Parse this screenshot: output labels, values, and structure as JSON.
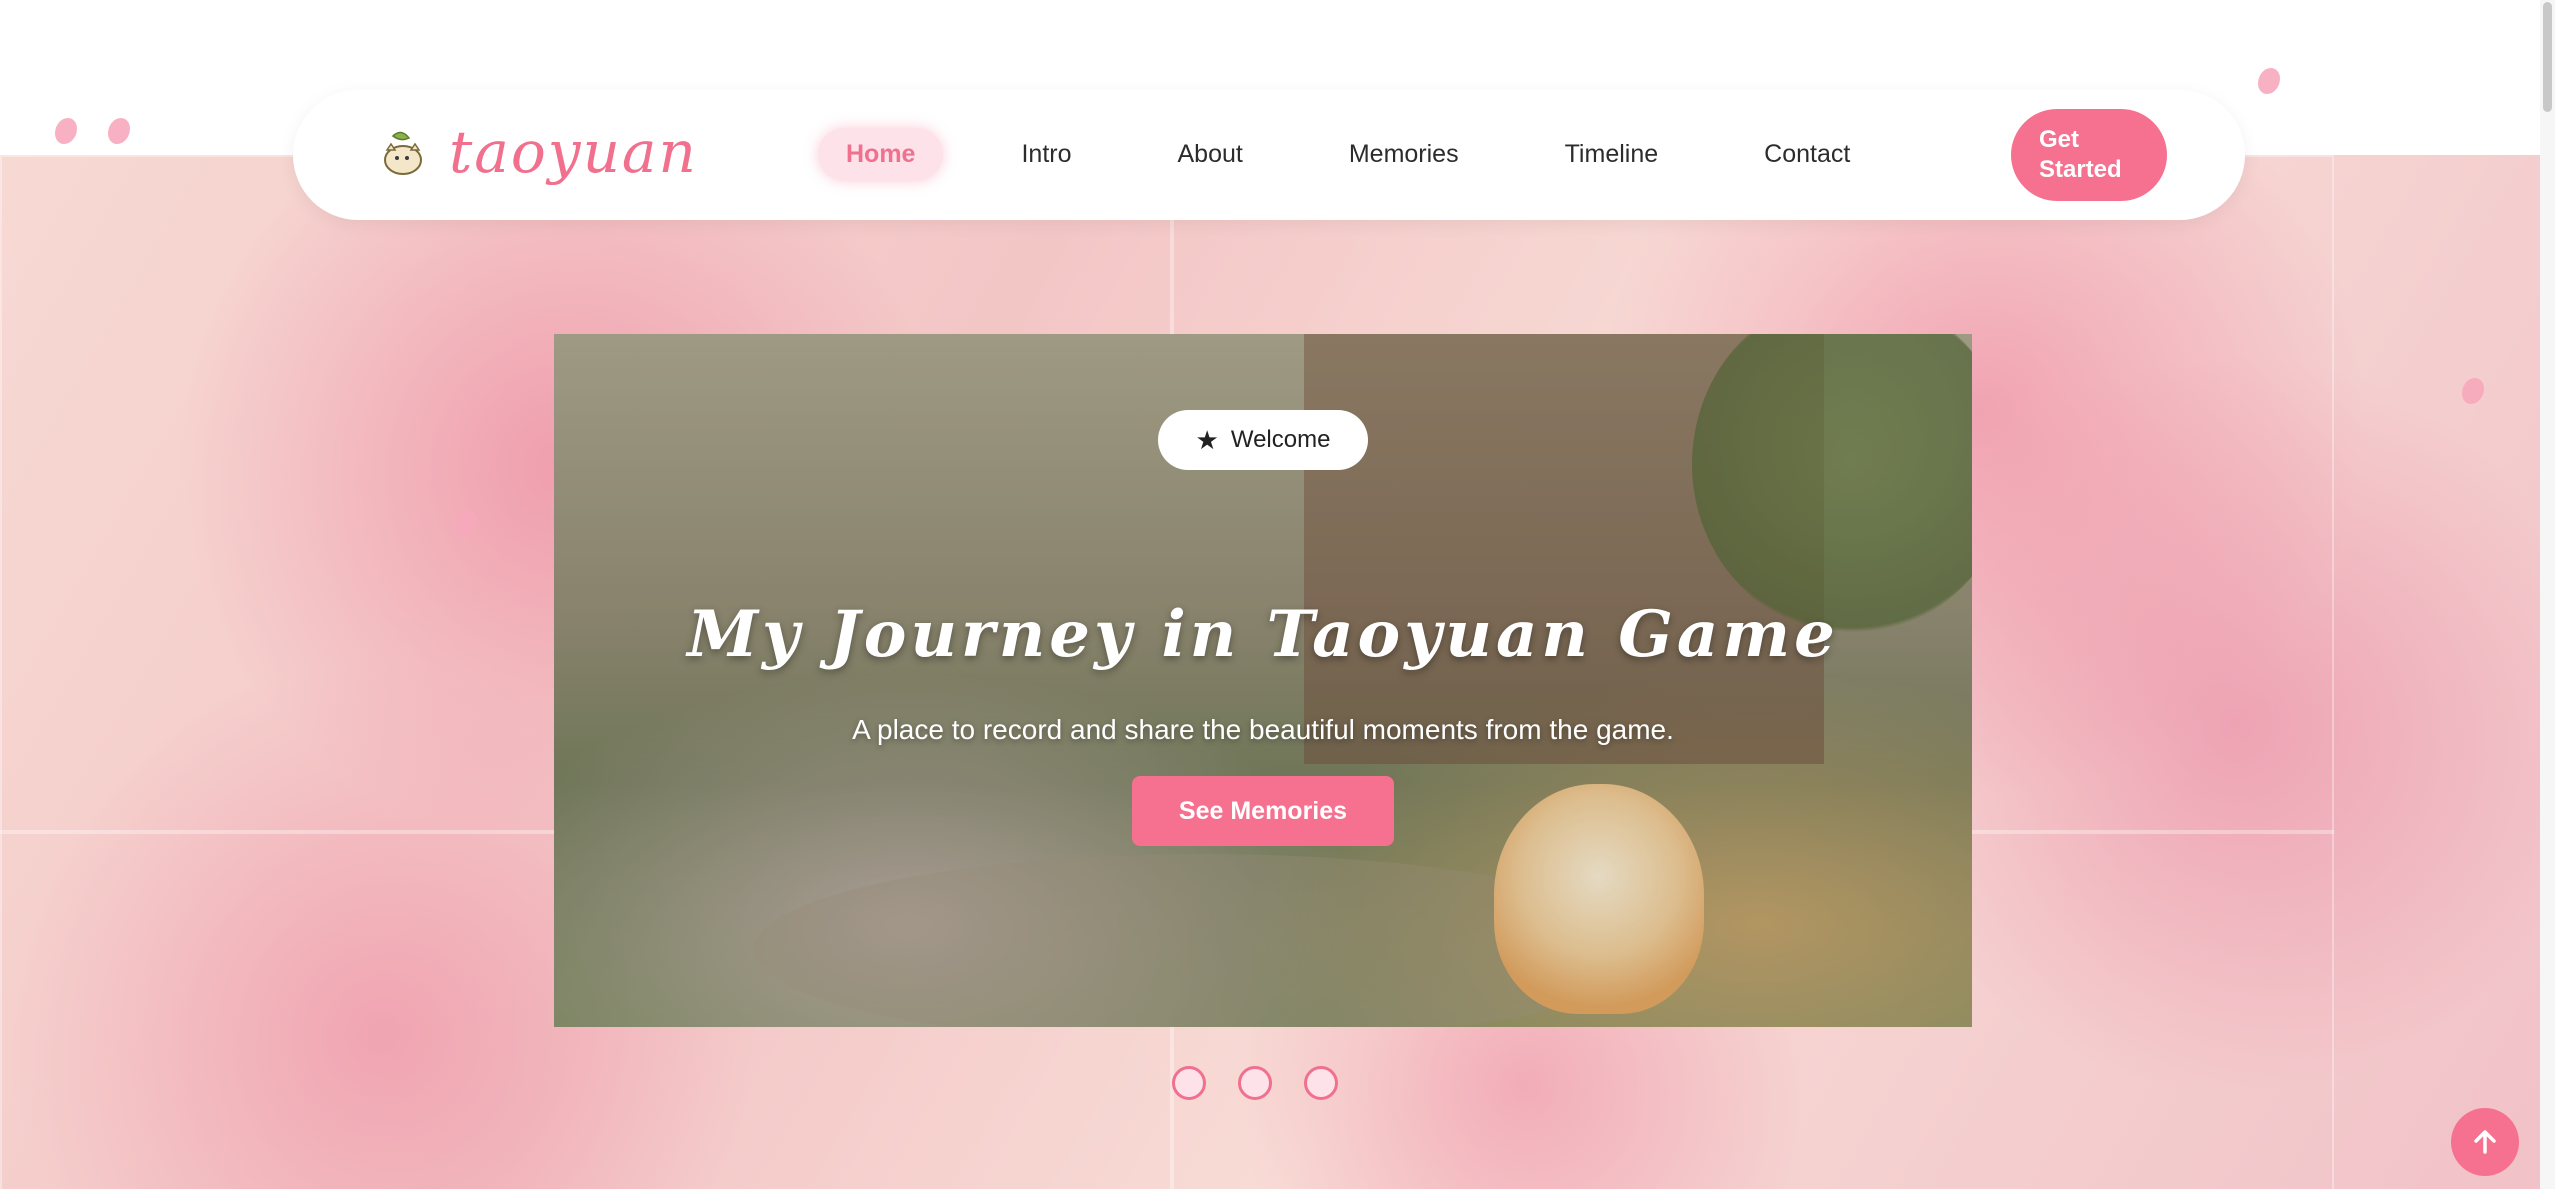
{
  "brand": {
    "name": "taoyuan",
    "logo_icon": "cat-leaf-icon",
    "accent": "#f5718f"
  },
  "nav": {
    "items": [
      {
        "label": "Home",
        "active": true
      },
      {
        "label": "Intro"
      },
      {
        "label": "About"
      },
      {
        "label": "Memories"
      },
      {
        "label": "Timeline"
      },
      {
        "label": "Contact"
      }
    ],
    "cta_label": "Get Started"
  },
  "hero": {
    "badge": {
      "icon": "star-icon",
      "label": "Welcome"
    },
    "title": "My Journey in Taoyuan Game",
    "subtitle": "A place to record and share the beautiful moments from the game.",
    "button_label": "See Memories"
  },
  "carousel": {
    "slides": 3
  },
  "scroll_top": {
    "icon": "arrow-up-icon"
  }
}
